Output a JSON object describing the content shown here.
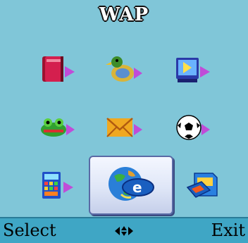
{
  "screen": {
    "title": "WAP",
    "menu_items": [
      {
        "icon": "book-icon"
      },
      {
        "icon": "bird-icon"
      },
      {
        "icon": "video-icon"
      },
      {
        "icon": "frog-icon"
      },
      {
        "icon": "envelope-icon"
      },
      {
        "icon": "soccer-ball-icon"
      },
      {
        "icon": "calculator-icon"
      },
      {
        "icon": "globe-icon",
        "selected": true
      },
      {
        "icon": "memory-card-icon"
      }
    ]
  },
  "softkeys": {
    "left_label": "Select",
    "right_label": "Exit",
    "center_icon": "navigation-arrows-icon"
  },
  "colors": {
    "background": "#80c6d8",
    "softkey_bar": "#3fa6c5",
    "selection_border": "#5a6aa5"
  }
}
